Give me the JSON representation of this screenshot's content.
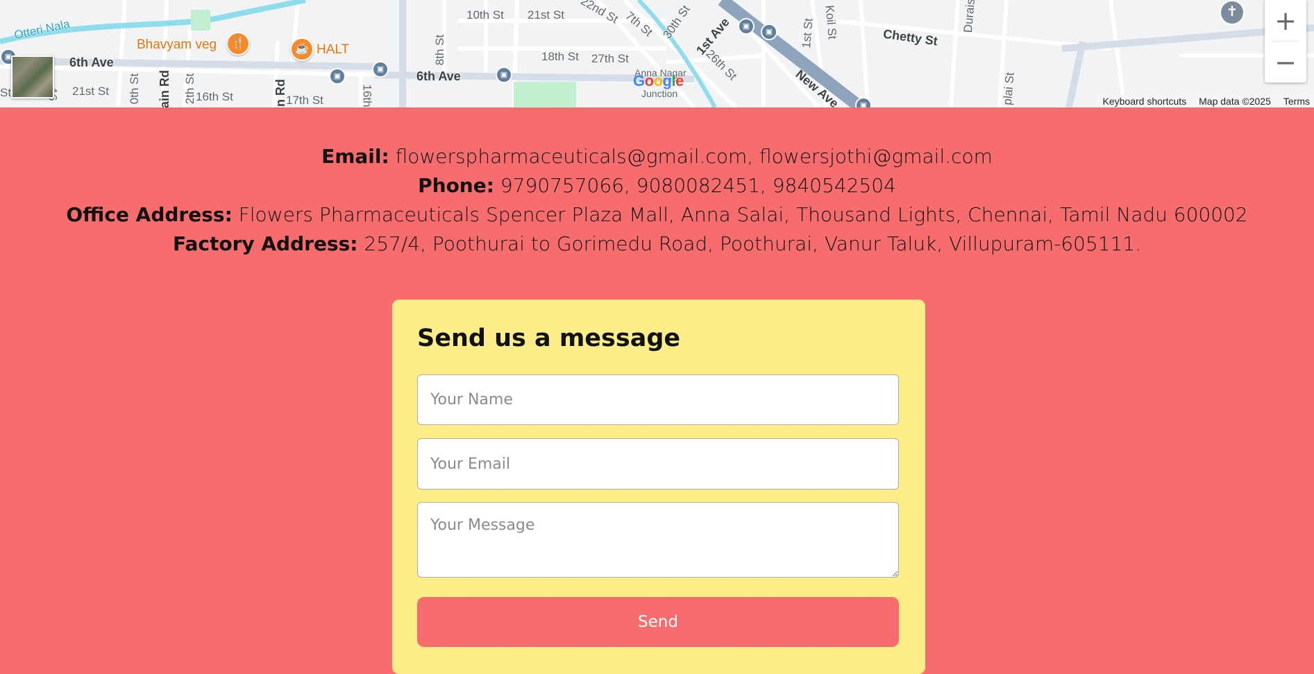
{
  "map": {
    "streets": [
      "10th St",
      "21st St",
      "22nd St",
      "7th St",
      "30th St",
      "1st Ave",
      "26th St",
      "New Ave",
      "1st St",
      "Koil St",
      "Chetty St",
      "Duraisa",
      "Otteri Nala",
      "6th Ave",
      "21st St",
      "0th St",
      "ain Rd",
      "2th St",
      "16th St",
      "in Rd",
      "17th St",
      "16th",
      "8th St",
      "18th St",
      "27th St",
      "6th Ave",
      "Anna Nagar",
      "Junction",
      "plai St",
      "St",
      "16"
    ],
    "pois": [
      {
        "name": "Bhavyam veg",
        "icon": "restaurant-icon"
      },
      {
        "name": "HALT",
        "icon": "cafe-icon"
      }
    ],
    "logo": [
      "G",
      "o",
      "o",
      "g",
      "l",
      "e"
    ],
    "attribution": {
      "shortcuts": "Keyboard shortcuts",
      "map_data": "Map data ©2025",
      "terms": "Terms"
    },
    "zoom": {
      "in": "+",
      "out": "−"
    }
  },
  "contact": {
    "email_label": "Email:",
    "email_value": "flowerspharmaceuticals@gmail.com, flowersjothi@gmail.com",
    "phone_label": "Phone:",
    "phone_value": "9790757066, 9080082451, 9840542504",
    "office_label": "Office Address:",
    "office_value": "Flowers Pharmaceuticals Spencer Plaza Mall, Anna Salai, Thousand Lights, Chennai, Tamil Nadu 600002",
    "factory_label": "Factory Address:",
    "factory_value": "257/4, Poothurai to Gorimedu Road, Poothurai, Vanur Taluk, Villupuram-605111."
  },
  "form": {
    "title": "Send us a message",
    "name_placeholder": "Your Name",
    "email_placeholder": "Your Email",
    "message_placeholder": "Your Message",
    "send_label": "Send"
  },
  "colors": {
    "page_bg": "#f76d6d",
    "card_bg": "#fdee8a",
    "button_bg": "#f76d6d"
  }
}
